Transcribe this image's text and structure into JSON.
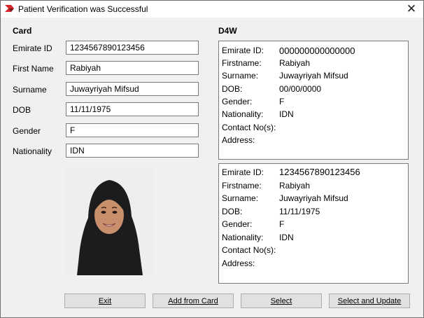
{
  "window": {
    "title": "Patient Verification was Successful"
  },
  "card": {
    "heading": "Card",
    "fields": [
      {
        "label": "Emirate ID",
        "value": "1234567890123456"
      },
      {
        "label": "First Name",
        "value": "Rabiyah"
      },
      {
        "label": "Surname",
        "value": "Juwayriyah Mifsud"
      },
      {
        "label": "DOB",
        "value": "11/11/1975"
      },
      {
        "label": "Gender",
        "value": "F"
      },
      {
        "label": "Nationality",
        "value": "IDN"
      }
    ]
  },
  "d4w": {
    "heading": "D4W",
    "labels": [
      "Emirate ID:",
      "Firstname:",
      "Surname:",
      "DOB:",
      "Gender:",
      "Nationality:",
      "Contact No(s):",
      "Address:"
    ],
    "records": [
      {
        "values": [
          "000000000000000",
          "Rabiyah",
          "Juwayriyah Mifsud",
          "00/00/0000",
          "F",
          "IDN",
          "",
          ""
        ]
      },
      {
        "values": [
          "1234567890123456",
          "Rabiyah",
          "Juwayriyah Mifsud",
          "11/11/1975",
          "F",
          "IDN",
          "",
          ""
        ]
      }
    ]
  },
  "buttons": {
    "exit": "Exit",
    "add_from_card": "Add from Card",
    "select": "Select",
    "select_and_update": "Select and Update"
  },
  "icons": {
    "app": "app-logo-icon",
    "close": "close-icon"
  }
}
